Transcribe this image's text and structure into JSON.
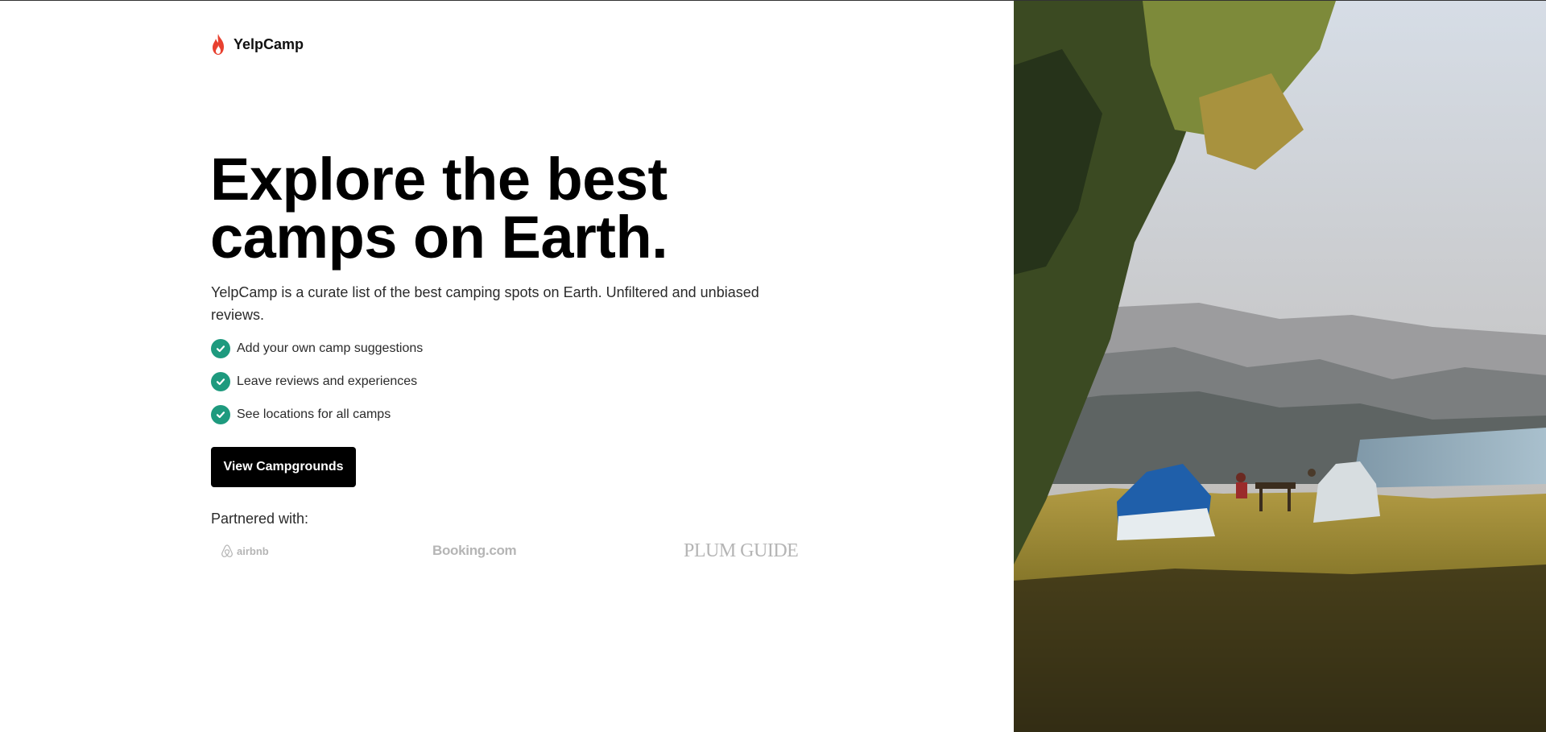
{
  "brand": {
    "name": "YelpCamp",
    "icon": "flame-icon",
    "icon_color": "#e8402f"
  },
  "hero": {
    "headline_line1": "Explore the best",
    "headline_line2": "camps on Earth.",
    "description": "YelpCamp is a curate list of the best camping spots on Earth. Unfiltered and unbiased reviews."
  },
  "features": [
    {
      "label": "Add your own camp suggestions",
      "icon": "check-circle-icon"
    },
    {
      "label": "Leave reviews and experiences",
      "icon": "check-circle-icon"
    },
    {
      "label": "See locations for all camps",
      "icon": "check-circle-icon"
    }
  ],
  "cta": {
    "label": "View Campgrounds"
  },
  "partners": {
    "label": "Partnered with:",
    "logos": [
      {
        "name": "airbnb"
      },
      {
        "name": "Booking.com"
      },
      {
        "name": "PLUM GUIDE"
      }
    ]
  },
  "colors": {
    "accent_check": "#1e9a7e",
    "button_bg": "#000000",
    "partner_logo": "#b5b5b5"
  },
  "image": {
    "subject": "two tents on a grassy hillside overlooking mountains and a lake under a tree"
  }
}
